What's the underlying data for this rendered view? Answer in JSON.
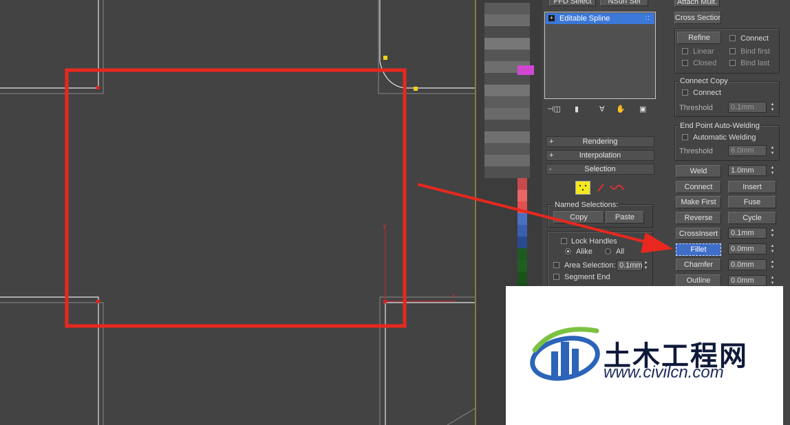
{
  "viewport": {
    "axis_y_label": "y",
    "axis_x_label": "x"
  },
  "stack": {
    "top_buttons": [
      "FFD Select",
      "NSurf Sel"
    ],
    "item_label": "Editable Spline",
    "item_expand": "+",
    "item_dots": "::"
  },
  "rollouts": {
    "rendering": "Rendering",
    "interpolation": "Interpolation",
    "selection": "Selection",
    "plus": "+",
    "minus": "-"
  },
  "selection": {
    "named_selections": "Named Selections:",
    "copy": "Copy",
    "paste": "Paste",
    "lock_handles": "Lock Handles",
    "alike": "Alike",
    "all": "All",
    "area_selection": "Area Selection:",
    "area_value": "0.1mm",
    "segment_end": "Segment End"
  },
  "geometry": {
    "attach_mult": "Attach Mult.",
    "cross_section": "Cross Section",
    "refine": "Refine",
    "connect": "Connect",
    "linear": "Linear",
    "bind_first": "Bind first",
    "closed": "Closed",
    "bind_last": "Bind last",
    "connect_copy": "Connect Copy",
    "connect2": "Connect",
    "threshold": "Threshold",
    "threshold_value": "0.1mm",
    "end_point": "End Point Auto-Welding",
    "automatic_welding": "Automatic Welding",
    "threshold2": "Threshold",
    "threshold2_value": "6.0mm",
    "weld": "Weld",
    "weld_value": "1.0mm",
    "connect_btn": "Connect",
    "insert": "Insert",
    "make_first": "Make First",
    "fuse": "Fuse",
    "reverse": "Reverse",
    "cycle": "Cycle",
    "crossinsert": "CrossInsert",
    "crossinsert_value": "0.1mm",
    "fillet": "Fillet",
    "fillet_value": "0.0mm",
    "chamfer": "Chamfer",
    "chamfer_value": "0.0mm",
    "outline": "Outline",
    "outline_value": "0.0mm"
  },
  "watermark": {
    "name": "土木工程网",
    "url": "www.civilcn.com"
  },
  "colors": {
    "highlight": "#e8281e",
    "active_button": "#3e6ec8",
    "stack_selected": "#3b78d8"
  }
}
